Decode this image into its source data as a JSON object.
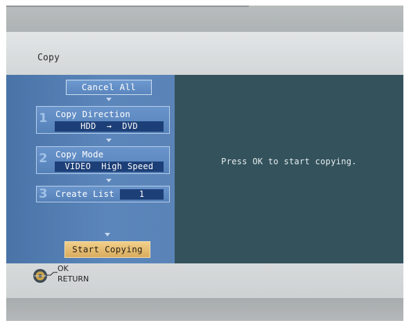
{
  "header": {
    "title": "Copy"
  },
  "steps": {
    "cancel_all": "Cancel All",
    "items": [
      {
        "number": "1",
        "label": "Copy Direction",
        "value": "HDD  →  DVD"
      },
      {
        "number": "2",
        "label": "Copy Mode",
        "value": "VIDEO  High Speed"
      },
      {
        "number": "3",
        "label": "Create List",
        "value": "1"
      }
    ],
    "start": "Start Copying"
  },
  "main": {
    "message": "Press OK to start copying."
  },
  "footer": {
    "ok": "OK",
    "return": "RETURN",
    "icon": "select-disc-icon"
  },
  "colors": {
    "panel_blue": "#5b86bb",
    "right_panel": "#33525c",
    "start_button": "#e6bd74",
    "value_field": "#1d3f77"
  }
}
